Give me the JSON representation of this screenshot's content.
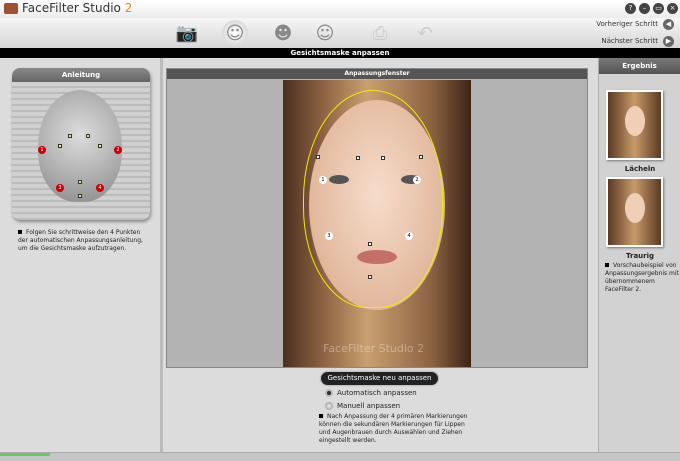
{
  "app": {
    "title": "FaceFilter Studio",
    "version": "2"
  },
  "window_buttons": [
    "?",
    "–",
    "▭",
    "×"
  ],
  "nav": {
    "prev": "Vorheriger Schritt",
    "next": "Nächster Schritt"
  },
  "step_title": "Gesichtsmaske anpassen",
  "left": {
    "header": "Anleitung",
    "text": "Folgen Sie schrittweise den 4 Punkten der automatischen Anpassungsanleitung, um die Gesichtsmaske aufzutragen.",
    "markers": [
      "1",
      "2",
      "3",
      "4"
    ]
  },
  "center": {
    "header": "Anpassungsfenster",
    "watermark": "FaceFilter Studio 2",
    "markers": [
      "1",
      "2",
      "3",
      "4"
    ]
  },
  "right": {
    "header": "Ergebnis",
    "labels": [
      "Lächeln",
      "Traurig"
    ],
    "text": "Vorschaubeispiel von Anpassungsergebnis mit übernommenem FaceFilter 2."
  },
  "controls": {
    "regen_button": "Gesichtsmaske neu anpassen",
    "radio_auto": "Automatisch anpassen",
    "radio_manual": "Manuell anpassen",
    "selected": "auto",
    "note": "Nach Anpassung der 4 primären Markierungen können die sekundären Markierungen für Lippen und Augenbrauen durch Auswählen und Ziehen eingestellt werden."
  }
}
